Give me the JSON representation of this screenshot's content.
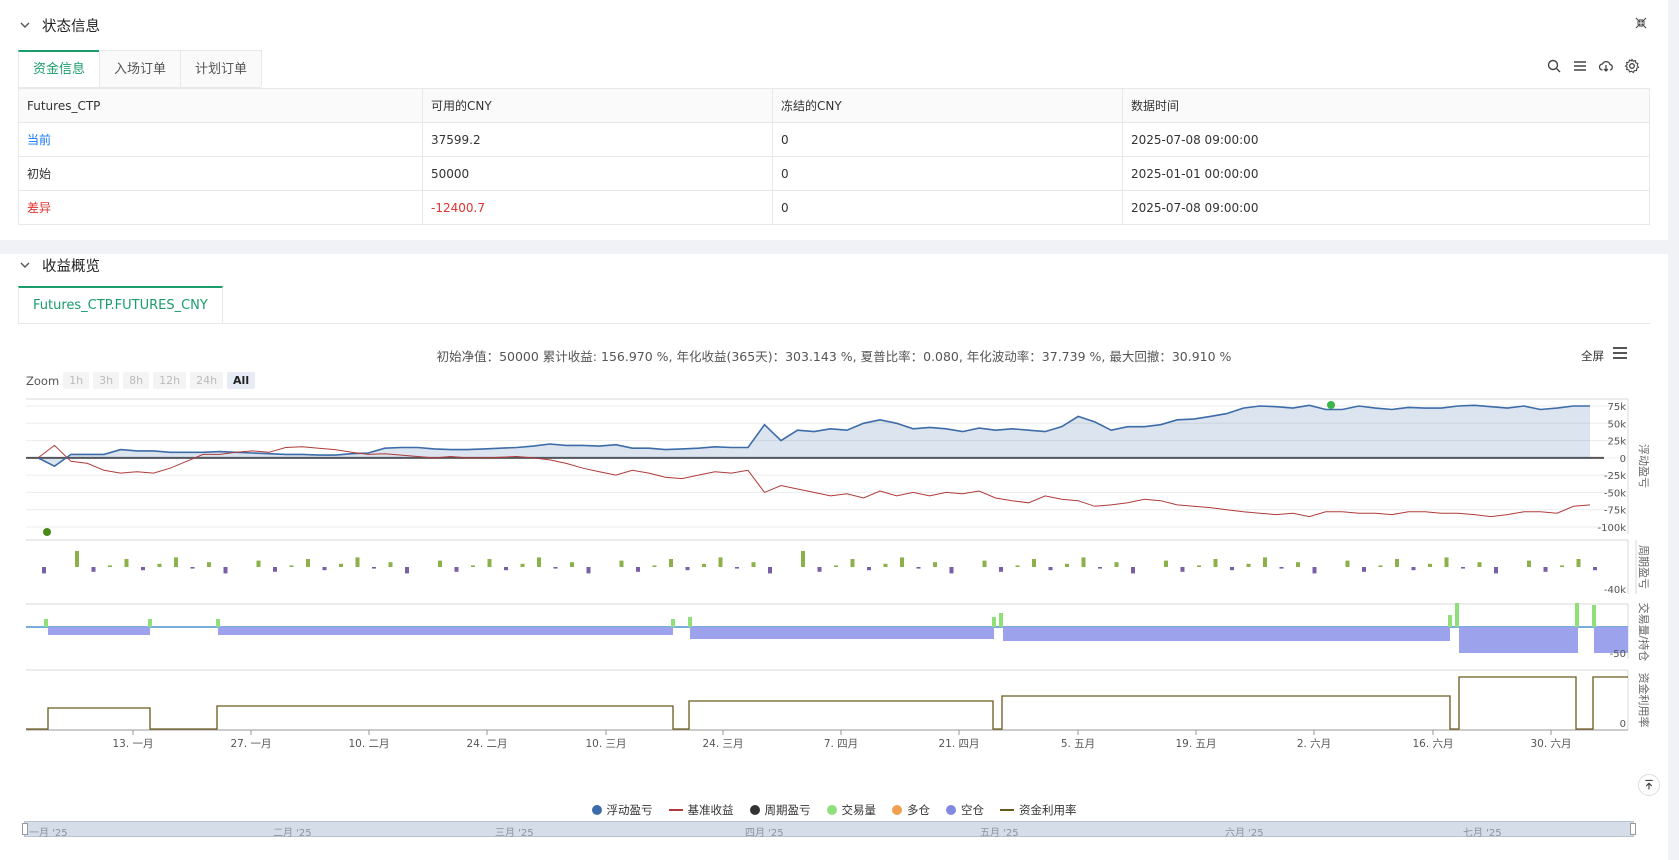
{
  "status_panel": {
    "title": "状态信息",
    "tabs": [
      {
        "label": "资金信息",
        "active": true
      },
      {
        "label": "入场订单",
        "active": false
      },
      {
        "label": "计划订单",
        "active": false
      }
    ],
    "table": {
      "headers": [
        "Futures_CTP",
        "可用的CNY",
        "冻结的CNY",
        "数据时间"
      ],
      "rows": [
        [
          "当前",
          "37599.2",
          "0",
          "2025-07-08 09:00:00"
        ],
        [
          "初始",
          "50000",
          "0",
          "2025-01-01 00:00:00"
        ],
        [
          "差异",
          "-12400.7",
          "0",
          "2025-07-08 09:00:00"
        ]
      ]
    },
    "toolbar_icons": [
      "search-icon",
      "list-icon",
      "cloud-download-icon",
      "settings-icon"
    ]
  },
  "returns_panel": {
    "title": "收益概览",
    "tab": "Futures_CTP.FUTURES_CNY",
    "summary": "初始净值：50000 累计收益: 156.970 %, 年化收益(365天)：303.143 %, 夏普比率：0.080, 年化波动率：37.739 %, 最大回撤：30.910 %",
    "fullscreen_label": "全屏",
    "zoom_label": "Zoom",
    "zoom_buttons": [
      "1h",
      "3h",
      "8h",
      "12h",
      "24h",
      "All"
    ],
    "zoom_active": "All",
    "legend": [
      {
        "label": "浮动盈亏",
        "color": "#3d6ca8",
        "shape": "dot"
      },
      {
        "label": "基准收益",
        "color": "#b03a3a",
        "shape": "line"
      },
      {
        "label": "周期盈亏",
        "color": "#333333",
        "shape": "dot"
      },
      {
        "label": "交易量",
        "color": "#90e07a",
        "shape": "dot"
      },
      {
        "label": "多仓",
        "color": "#f0a050",
        "shape": "dot"
      },
      {
        "label": "空仓",
        "color": "#8088e0",
        "shape": "dot"
      },
      {
        "label": "资金利用率",
        "color": "#6b5a1e",
        "shape": "line"
      }
    ],
    "navigator_labels": [
      "一月 '25",
      "二月 '25",
      "三月 '25",
      "四月 '25",
      "五月 '25",
      "六月 '25",
      "七月 '25"
    ]
  },
  "chart_data": {
    "type": "line",
    "x_tick_labels": [
      "13. 一月",
      "27. 一月",
      "10. 二月",
      "24. 二月",
      "10. 三月",
      "24. 三月",
      "7. 四月",
      "21. 四月",
      "5. 五月",
      "19. 五月",
      "2. 六月",
      "16. 六月",
      "30. 六月"
    ],
    "panes": [
      {
        "axis_title": "浮动盈亏",
        "y_tick_labels": [
          "75k",
          "50k",
          "25k",
          "0",
          "-25k",
          "-50k",
          "-75k",
          "-100k"
        ],
        "ylim": [
          -100000,
          75000
        ],
        "series": [
          {
            "name": "浮动盈亏",
            "color": "#3d6ca8",
            "type": "area",
            "values": [
              0,
              -12000,
              5000,
              5000,
              5000,
              12000,
              10000,
              10000,
              8000,
              8000,
              8000,
              9000,
              8000,
              7000,
              6000,
              5000,
              5000,
              4000,
              4000,
              6000,
              7000,
              14000,
              15000,
              15000,
              13000,
              12000,
              12000,
              13000,
              14000,
              15000,
              17000,
              20000,
              18000,
              18000,
              17000,
              19000,
              14000,
              14000,
              12000,
              13000,
              14000,
              16000,
              15000,
              15000,
              48000,
              25000,
              40000,
              38000,
              42000,
              40000,
              50000,
              55000,
              50000,
              42000,
              44000,
              42000,
              38000,
              43000,
              40000,
              42000,
              40000,
              38000,
              45000,
              60000,
              52000,
              40000,
              45000,
              45000,
              48000,
              55000,
              56000,
              60000,
              64000,
              72000,
              75000,
              74000,
              72000,
              76000,
              70000,
              70000,
              75000,
              72000,
              70000,
              73000,
              72000,
              72000,
              75000,
              76000,
              74000,
              72000,
              75000,
              70000,
              72000,
              75000,
              75000
            ]
          },
          {
            "name": "基准收益",
            "color": "#b03a3a",
            "type": "line",
            "values": [
              0,
              18000,
              -5000,
              -8000,
              -18000,
              -22000,
              -20000,
              -22000,
              -15000,
              -5000,
              5000,
              5000,
              8000,
              10000,
              8000,
              15000,
              16000,
              14000,
              12000,
              8000,
              5000,
              6000,
              4000,
              2000,
              0,
              2000,
              0,
              0,
              1000,
              2000,
              0,
              -3000,
              -8000,
              -15000,
              -20000,
              -25000,
              -18000,
              -22000,
              -28000,
              -30000,
              -25000,
              -20000,
              -22000,
              -18000,
              -50000,
              -40000,
              -45000,
              -50000,
              -55000,
              -52000,
              -58000,
              -48000,
              -55000,
              -50000,
              -55000,
              -50000,
              -52000,
              -48000,
              -58000,
              -62000,
              -65000,
              -55000,
              -60000,
              -62000,
              -70000,
              -68000,
              -65000,
              -60000,
              -62000,
              -68000,
              -70000,
              -72000,
              -75000,
              -78000,
              -80000,
              -82000,
              -80000,
              -85000,
              -78000,
              -78000,
              -80000,
              -80000,
              -82000,
              -78000,
              -78000,
              -80000,
              -80000,
              -82000,
              -85000,
              -82000,
              -78000,
              -78000,
              -80000,
              -70000,
              -68000
            ]
          }
        ]
      },
      {
        "axis_title": "周期盈亏",
        "y_tick_labels": [
          "-40k"
        ]
      },
      {
        "axis_title": "交易量/持仓",
        "y_tick_labels": [
          "-50"
        ]
      },
      {
        "axis_title": "资金利用率",
        "y_tick_labels": [
          "0"
        ]
      }
    ]
  }
}
